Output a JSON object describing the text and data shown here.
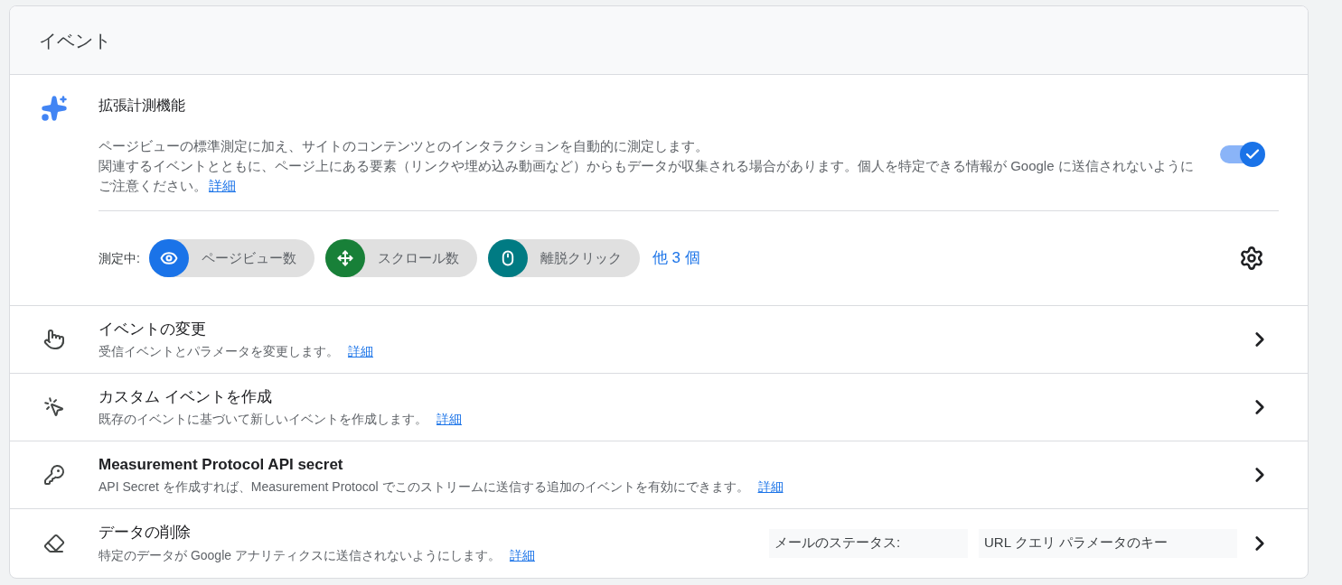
{
  "card": {
    "title": "イベント"
  },
  "enhanced": {
    "title": "拡張計測機能",
    "paragraphs": [
      "ページビューの標準測定に加え、サイトのコンテンツとのインタラクションを自動的に測定します。",
      "関連するイベントとともに、ページ上にある要素（リンクや埋め込み動画など）からもデータが収集される場合があります。個人を特定できる情報が Google に送信されないようにご注意ください。"
    ],
    "link": "詳細",
    "toggle_on": true,
    "measuring_label": "測定中:",
    "chips": [
      {
        "kind": "eye",
        "label": "ページビュー数",
        "color": "#1a73e8"
      },
      {
        "kind": "scroll",
        "label": "スクロール数",
        "color": "#188038"
      },
      {
        "kind": "mouse",
        "label": "離脱クリック",
        "color": "#007b83"
      }
    ],
    "more": "他 3 個"
  },
  "rows": [
    {
      "kind": "touch",
      "title": "イベントの変更",
      "bold": false,
      "description": "受信イベントとパラメータを変更します。",
      "link": "詳細"
    },
    {
      "kind": "click",
      "title": "カスタム イベントを作成",
      "bold": false,
      "description": "既存のイベントに基づいて新しいイベントを作成します。",
      "link": "詳細"
    },
    {
      "kind": "key",
      "title": "Measurement Protocol API secret",
      "bold": true,
      "description": "API Secret を作成すれば、Measurement Protocol でこのストリームに送信する追加のイベントを有効にできます。",
      "link": "詳細"
    },
    {
      "kind": "eraser",
      "title": "データの削除",
      "bold": false,
      "description": "特定のデータが Google アナリティクスに送信されないようにします。",
      "link": "詳細",
      "tags": [
        "メールのステータス:",
        "URL クエリ パラメータのキー"
      ]
    }
  ]
}
